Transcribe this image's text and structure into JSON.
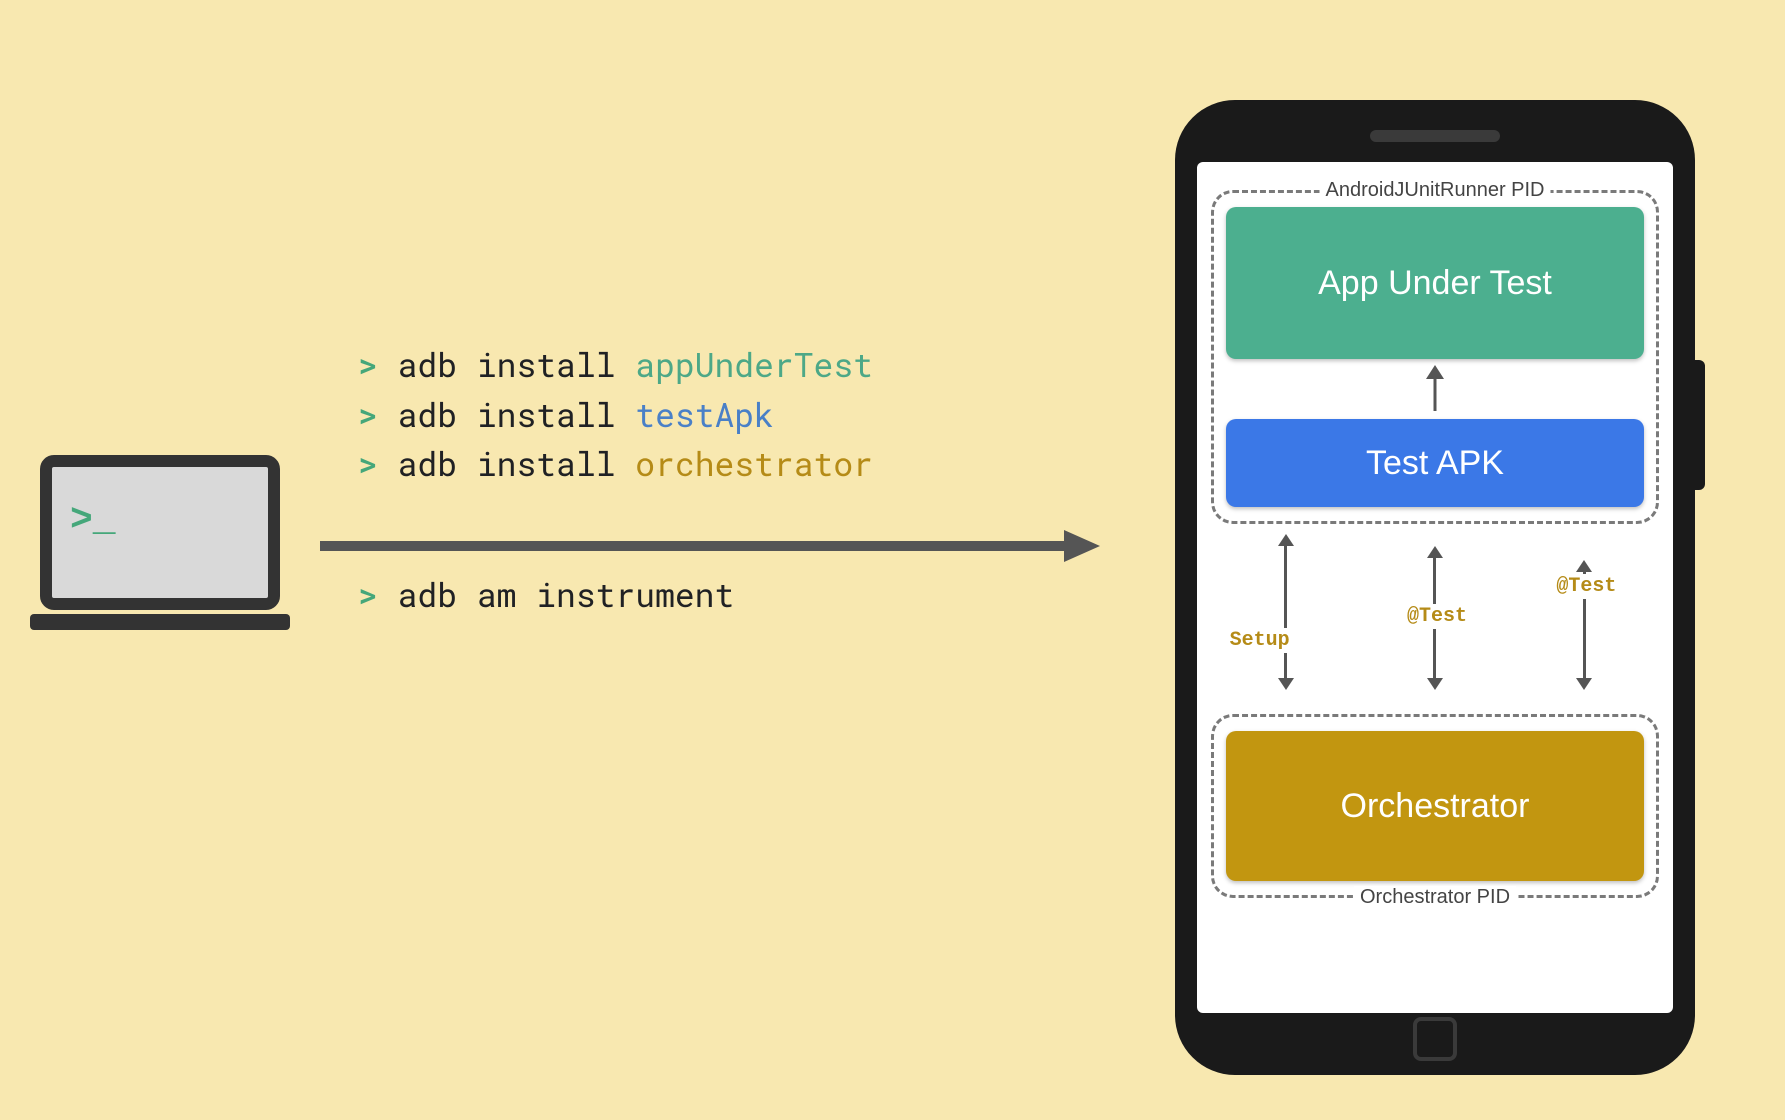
{
  "laptop": {
    "prompt": ">_"
  },
  "commands": {
    "line1": {
      "prompt": ">",
      "cmd": "adb install",
      "arg": "appUnderTest"
    },
    "line2": {
      "prompt": ">",
      "cmd": "adb install",
      "arg": "testApk"
    },
    "line3": {
      "prompt": ">",
      "cmd": "adb install",
      "arg": "orchestrator"
    },
    "line4": {
      "prompt": ">",
      "cmd": "adb am instrument"
    }
  },
  "phone": {
    "topPid": {
      "label": "AndroidJUnitRunner PID",
      "appUnderTest": "App Under Test",
      "testApk": "Test APK"
    },
    "arrows": {
      "setup": "Setup",
      "test1": "@Test",
      "test2": "@Test"
    },
    "bottomPid": {
      "label": "Orchestrator PID",
      "orchestrator": "Orchestrator"
    }
  }
}
